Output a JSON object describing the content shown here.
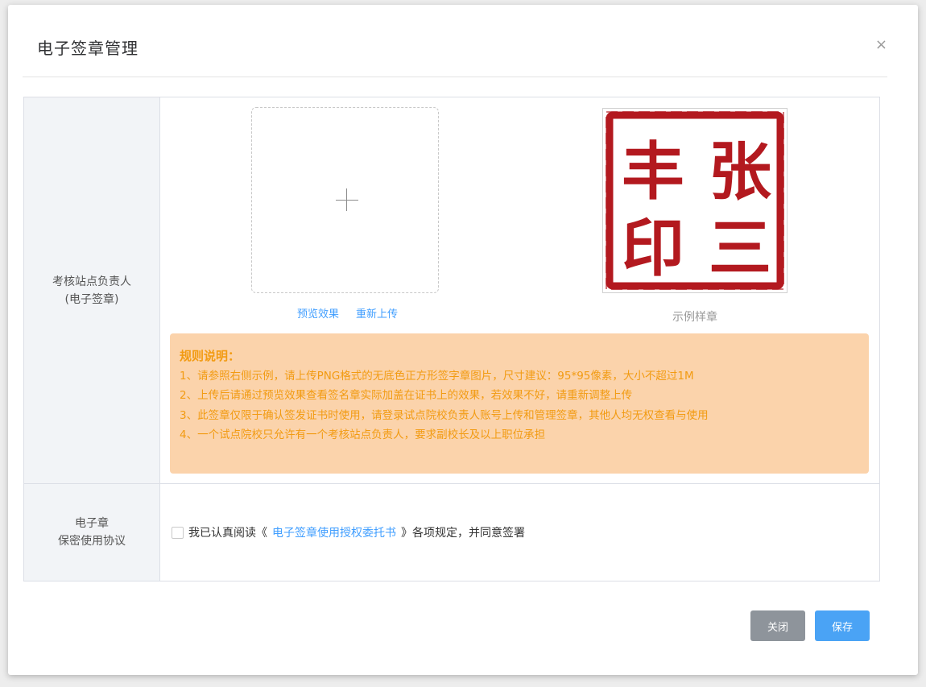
{
  "dialog": {
    "title": "电子签章管理",
    "close_icon": "×"
  },
  "row1": {
    "label_line1": "考核站点负责人",
    "label_line2": "(电子签章)",
    "uploader_icon": "plus-icon",
    "preview_link": "预览效果",
    "reupload_link": "重新上传",
    "sample_caption": "示例样章",
    "sample_seal_chars": [
      "张",
      "三",
      "丰",
      "印"
    ],
    "rules": {
      "title": "规则说明：",
      "items": [
        "1、请参照右侧示例，请上传PNG格式的无底色正方形签字章图片，尺寸建议：95*95像素，大小不超过1M",
        "2、上传后请通过预览效果查看签名章实际加盖在证书上的效果，若效果不好，请重新调整上传",
        "3、此签章仅限于确认签发证书时使用，请登录试点院校负责人账号上传和管理签章，其他人均无权查看与使用",
        "4、一个试点院校只允许有一个考核站点负责人，要求副校长及以上职位承担"
      ]
    }
  },
  "row2": {
    "label_line1": "电子章",
    "label_line2": "保密使用协议",
    "agree_prefix": "我已认真阅读《",
    "agree_link": "电子签章使用授权委托书",
    "agree_suffix": "》各项规定，并同意签署"
  },
  "buttons": {
    "close": "关闭",
    "save": "保存"
  },
  "colors": {
    "seal_red": "#b3191f",
    "rules_bg": "#fbd3ab",
    "rules_text": "#f29b12",
    "link": "#409eff",
    "save_btn": "#4aa3f5",
    "close_btn": "#8e949b"
  }
}
